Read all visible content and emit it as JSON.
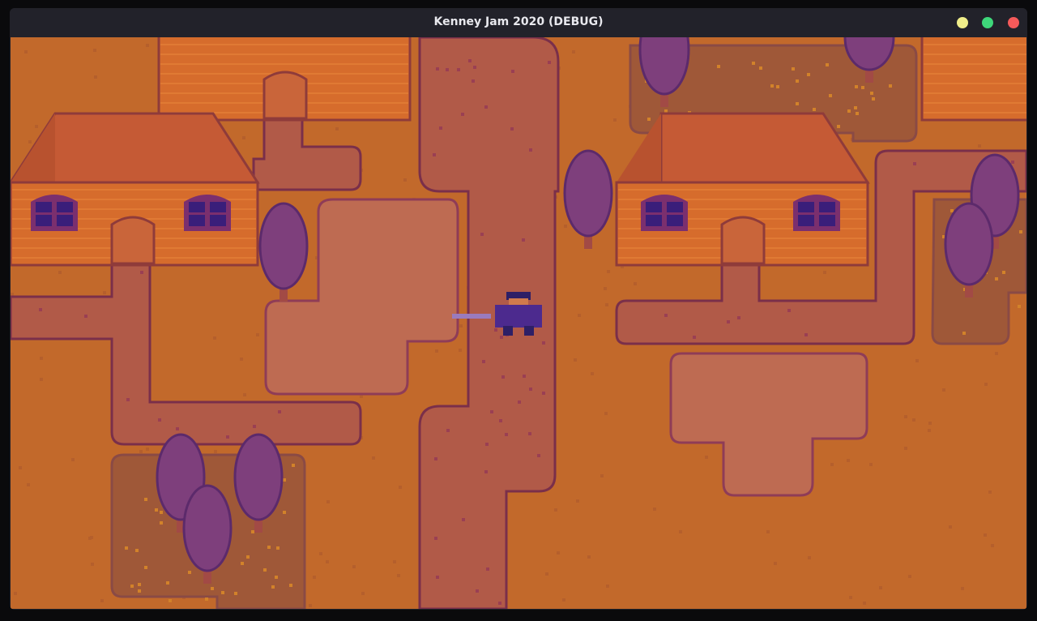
{
  "window": {
    "title": "Kenney Jam 2020 (DEBUG)",
    "buttons": [
      {
        "name": "minimize",
        "color": "#f0ee8a"
      },
      {
        "name": "maximize",
        "color": "#3ed77a"
      },
      {
        "name": "close",
        "color": "#f55a5a"
      }
    ]
  },
  "palette": {
    "ground": "#c2692b",
    "ground_speck": "#b55f2c",
    "path": "#b15a48",
    "path_edge": "#7a2f4a",
    "path_speck": "#9a3f53",
    "pond": "#be6b52",
    "pond_rim": "#c67a64",
    "pond_edge": "#8f3c57",
    "hedge": "#9f5838",
    "hedge_edge": "#8a4a45",
    "hedge_dot": "#d2822a",
    "tree": "#7e3f7c",
    "tree_edge": "#5c2a6b",
    "trunk": "#a24a45",
    "house_wall": "#d66c2c",
    "house_wall_line": "#e07a34",
    "house_roof": "#c55a35",
    "house_roof_side": "#b8522f",
    "house_edge": "#8f3b3a",
    "window_glass": "#3a1e7a",
    "window_frame": "#7b2f6e",
    "door": "#c9653a",
    "player_body": "#4c2a8e",
    "player_dark": "#2e1f66",
    "player_skin": "#d07a4c",
    "sword": "#9a7bbd"
  }
}
